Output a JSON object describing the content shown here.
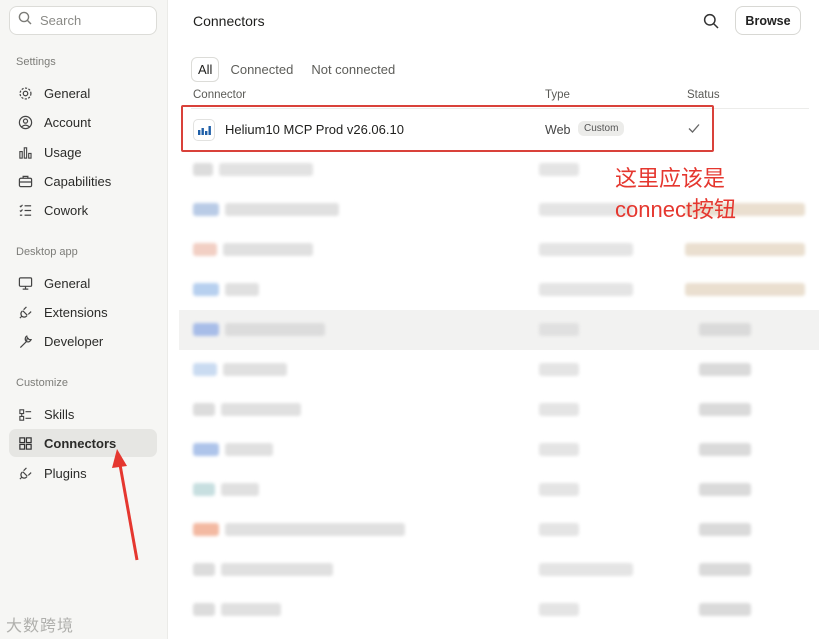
{
  "sidebar": {
    "search_placeholder": "Search",
    "sections": [
      {
        "label": "Settings",
        "items": [
          {
            "label": "General",
            "icon": "gear-icon"
          },
          {
            "label": "Account",
            "icon": "user-circle-icon"
          },
          {
            "label": "Usage",
            "icon": "bar-chart-icon"
          },
          {
            "label": "Capabilities",
            "icon": "briefcase-icon"
          },
          {
            "label": "Cowork",
            "icon": "list-check-icon"
          }
        ]
      },
      {
        "label": "Desktop app",
        "items": [
          {
            "label": "General",
            "icon": "monitor-icon"
          },
          {
            "label": "Extensions",
            "icon": "plug-icon"
          },
          {
            "label": "Developer",
            "icon": "wrench-icon"
          }
        ]
      },
      {
        "label": "Customize",
        "items": [
          {
            "label": "Skills",
            "icon": "skills-icon"
          },
          {
            "label": "Connectors",
            "icon": "grid-icon"
          },
          {
            "label": "Plugins",
            "icon": "plug-icon"
          }
        ]
      }
    ]
  },
  "header": {
    "title": "Connectors",
    "browse_label": "Browse"
  },
  "tabs": [
    "All",
    "Connected",
    "Not connected"
  ],
  "columns": {
    "connector": "Connector",
    "type": "Type",
    "status": "Status"
  },
  "connector_row": {
    "name": "Helium10 MCP Prod v26.06.10",
    "type": "Web",
    "badge": "Custom",
    "status": "connected"
  },
  "annotation": {
    "line1": "这里应该是",
    "line2": "connect按钮",
    "color": "#e5372f"
  },
  "watermark": "大数跨境",
  "colors": {
    "accent_red": "#d9413a",
    "sidebar_bg": "#f6f6f4",
    "active_bg": "#e6e6e3"
  }
}
